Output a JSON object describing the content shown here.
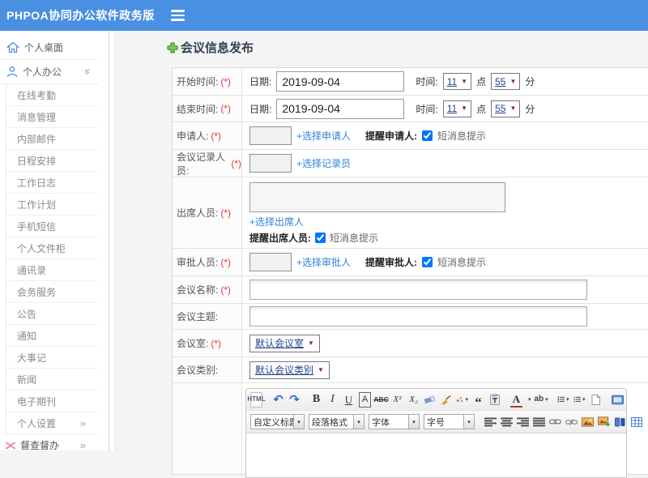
{
  "topbar": {
    "title": "PHPOA协同办公软件政务版"
  },
  "sidebar": {
    "desktop": "个人桌面",
    "office": "个人办公",
    "submenu": [
      "在线考勤",
      "消息管理",
      "内部邮件",
      "日程安排",
      "工作日志",
      "工作计划",
      "手机短信",
      "个人文件柜",
      "通讯录",
      "会务服务",
      "公告",
      "通知",
      "大事记",
      "新闻",
      "电子期刊"
    ],
    "settings": "个人设置",
    "supervise": "督查督办"
  },
  "page": {
    "title": "会议信息发布"
  },
  "form": {
    "start": {
      "label": "开始时间:",
      "req": "(*)",
      "date_label": "日期:",
      "date": "2019-09-04",
      "time_label": "时间:",
      "hour": "11",
      "dot": "点",
      "minute": "55",
      "fen": "分"
    },
    "end": {
      "label": "结束时间:",
      "req": "(*)",
      "date_label": "日期:",
      "date": "2019-09-04",
      "time_label": "时间:",
      "hour": "11",
      "dot": "点",
      "minute": "55",
      "fen": "分"
    },
    "applicant": {
      "label": "申请人:",
      "req": "(*)",
      "value": "",
      "choose": "+选择申请人",
      "remind": "提醒申请人:",
      "sms": "短消息提示",
      "checked": true
    },
    "recorder": {
      "label": "会议记录人员:",
      "req": "(*)",
      "value": "",
      "choose": "+选择记录员"
    },
    "attendee": {
      "label": "出席人员:",
      "req": "(*)",
      "value": "",
      "choose": "+选择出席人",
      "remind": "提醒出席人员:",
      "sms": "短消息提示",
      "checked": true
    },
    "approver": {
      "label": "审批人员:",
      "req": "(*)",
      "value": "",
      "choose": "+选择审批人",
      "remind": "提醒审批人:",
      "sms": "短消息提示",
      "checked": true
    },
    "name": {
      "label": "会议名称:",
      "req": "(*)",
      "value": ""
    },
    "subject": {
      "label": "会议主题:",
      "value": ""
    },
    "room": {
      "label": "会议室:",
      "req": "(*)",
      "value": "默认会议室"
    },
    "category": {
      "label": "会议类别:",
      "value": "默认会议类别"
    }
  },
  "editor": {
    "html": "HTML",
    "undo": "↶",
    "redo": "↷",
    "bold": "B",
    "italic": "I",
    "underline": "U",
    "fontbox": "A",
    "strike": "ABC",
    "sup": "X²",
    "sub": "X₂",
    "quote": "“",
    "fontcolor": "A",
    "highlight": "ab",
    "heading_select": "自定义标题",
    "paragraph_select": "段落格式",
    "font_select": "字体",
    "size_select": "字号"
  },
  "icons": {
    "select_arrow": "▼",
    "dropdown_arrow": "▾",
    "chevron_right": "»",
    "chevron_down": "»"
  },
  "colors": {
    "topbar": "#4a90e2",
    "link": "#2e82d9",
    "plus_green": "#57b33c",
    "required": "#f03333"
  }
}
